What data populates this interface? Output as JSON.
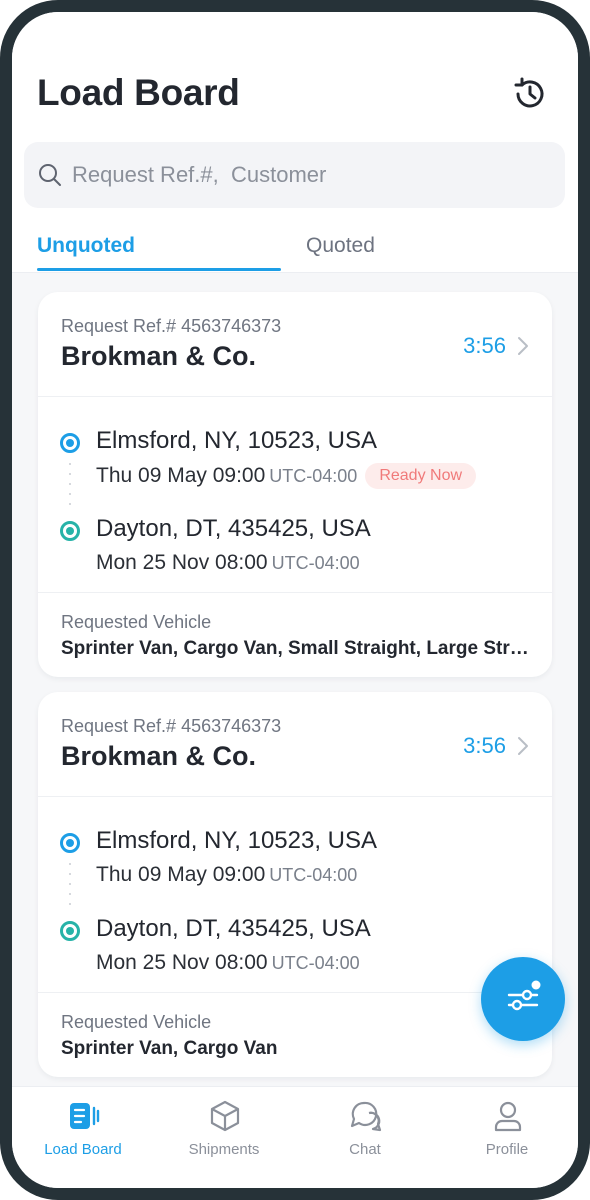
{
  "header": {
    "title": "Load Board",
    "history_icon": "history-icon"
  },
  "search": {
    "placeholder": "Request Ref.#,  Customer",
    "value": "",
    "icon": "search-icon"
  },
  "tabs": [
    {
      "label": "Unquoted",
      "active": true
    },
    {
      "label": "Quoted",
      "active": false
    }
  ],
  "loads": [
    {
      "ref_label": "Request Ref.# 4563746373",
      "customer": "Brokman & Co.",
      "timer": "3:56",
      "origin": {
        "place": "Elmsford, NY, 10523, USA",
        "datetime": "Thu 09 May 09:00",
        "tz": "UTC-04:00",
        "badge": "Ready Now"
      },
      "destination": {
        "place": "Dayton, DT, 435425, USA",
        "datetime": "Mon 25 Nov 08:00",
        "tz": "UTC-04:00"
      },
      "vehicle_label": "Requested Vehicle",
      "vehicle_value": "Sprinter Van, Cargo Van, Small Straight, Large Straight"
    },
    {
      "ref_label": "Request Ref.# 4563746373",
      "customer": "Brokman & Co.",
      "timer": "3:56",
      "origin": {
        "place": "Elmsford, NY, 10523, USA",
        "datetime": "Thu 09 May 09:00",
        "tz": "UTC-04:00"
      },
      "destination": {
        "place": "Dayton, DT, 435425, USA",
        "datetime": "Mon 25 Nov 08:00",
        "tz": "UTC-04:00"
      },
      "vehicle_label": "Requested Vehicle",
      "vehicle_value": "Sprinter Van, Cargo Van"
    }
  ],
  "fab": {
    "icon": "filter-sliders-icon"
  },
  "bottom_nav": [
    {
      "label": "Load Board",
      "icon": "load-board-icon",
      "active": true
    },
    {
      "label": "Shipments",
      "icon": "box-icon",
      "active": false
    },
    {
      "label": "Chat",
      "icon": "chat-icon",
      "active": false
    },
    {
      "label": "Profile",
      "icon": "user-icon",
      "active": false
    }
  ],
  "colors": {
    "accent": "#1d9ee6",
    "destination": "#27b3a8",
    "badge_text": "#f07a7a",
    "badge_bg": "#fdeceb",
    "frame": "#263238"
  }
}
